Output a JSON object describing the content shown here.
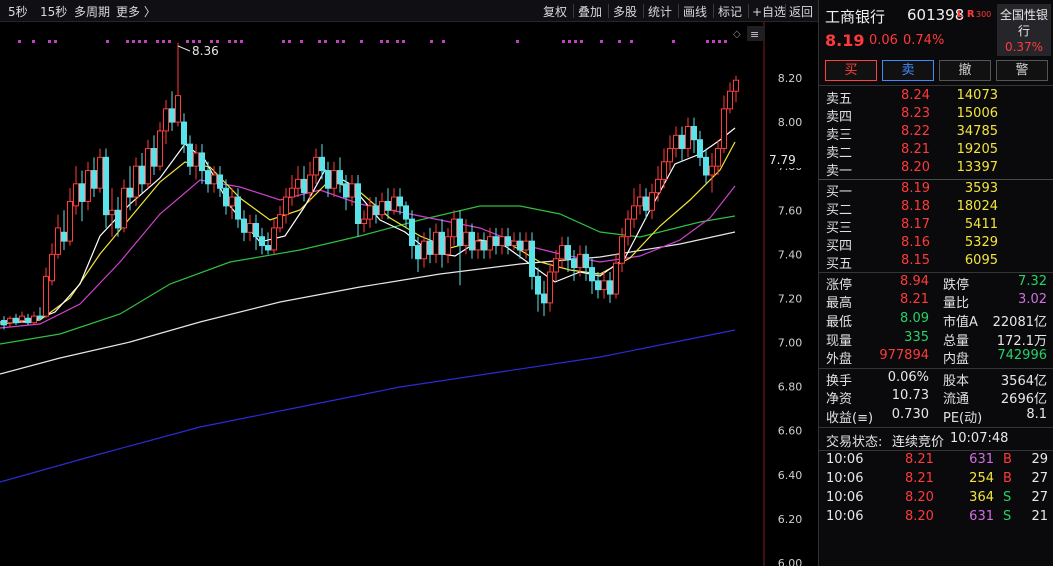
{
  "toolbar": {
    "left": [
      "5秒",
      "15秒",
      "多周期",
      "更多 〉"
    ],
    "right": [
      "复权",
      "叠加",
      "多股",
      "统计",
      "画线",
      "标记",
      "+自选",
      "返回"
    ]
  },
  "chart": {
    "peak_label": "8.36",
    "current_price_tag": "7.79",
    "y_ticks": [
      "8.20",
      "8.00",
      "7.80",
      "7.60",
      "7.40",
      "7.20",
      "7.00",
      "6.80",
      "6.60",
      "6.40",
      "6.20",
      "6.00"
    ],
    "colors": {
      "up": "#ff3b3b",
      "down": "#5be3ea",
      "ma5": "#ffffff",
      "ma10": "#f2e53c",
      "ma20": "#d040d0",
      "ma60": "#2fbf3f",
      "ma120": "#e6e6e6",
      "ma250": "#2b2bd8",
      "dots": "#c040c0"
    }
  },
  "stock": {
    "name": "工商银行",
    "code": "601398",
    "lr": "L R",
    "index": "300",
    "price": "8.19",
    "change": "0.06",
    "change_pct": "0.74%",
    "sector_line1": "全国性银",
    "sector_line2": "行",
    "sector_pct": "0.37%"
  },
  "buttons": {
    "buy": "买",
    "sell": "卖",
    "cancel": "撤",
    "alert": "警"
  },
  "order_book": {
    "asks": [
      {
        "label": "卖五",
        "price": "8.24",
        "volume": "14073"
      },
      {
        "label": "卖四",
        "price": "8.23",
        "volume": "15006"
      },
      {
        "label": "卖三",
        "price": "8.22",
        "volume": "34785"
      },
      {
        "label": "卖二",
        "price": "8.21",
        "volume": "19205"
      },
      {
        "label": "卖一",
        "price": "8.20",
        "volume": "13397"
      }
    ],
    "bids": [
      {
        "label": "买一",
        "price": "8.19",
        "volume": "3593"
      },
      {
        "label": "买二",
        "price": "8.18",
        "volume": "18024"
      },
      {
        "label": "买三",
        "price": "8.17",
        "volume": "5411"
      },
      {
        "label": "买四",
        "price": "8.16",
        "volume": "5329"
      },
      {
        "label": "买五",
        "price": "8.15",
        "volume": "6095"
      }
    ]
  },
  "stats": {
    "limit_up_label": "涨停",
    "limit_up": "8.94",
    "limit_down_label": "跌停",
    "limit_down": "7.32",
    "high_label": "最高",
    "high": "8.21",
    "vol_ratio_label": "量比",
    "vol_ratio": "3.02",
    "low_label": "最低",
    "low": "8.09",
    "mktcap_label": "市值A",
    "mktcap": "22081亿",
    "current_vol_label": "现量",
    "current_vol": "335",
    "total_vol_label": "总量",
    "total_vol": "172.1万",
    "outer_label": "外盘",
    "outer": "977894",
    "inner_label": "内盘",
    "inner": "742996",
    "turnover_label": "换手",
    "turnover": "0.06%",
    "shares_label": "股本",
    "shares": "3564亿",
    "nav_label": "净资",
    "nav": "10.73",
    "float_label": "流通",
    "float": "2696亿",
    "eps_label": "收益(≡)",
    "eps": "0.730",
    "pe_label": "PE(动)",
    "pe": "8.1"
  },
  "trade_status": {
    "label": "交易状态:",
    "value": "连续竞价",
    "time": "10:07:48"
  },
  "ticks": [
    {
      "time": "10:06",
      "price": "8.21",
      "vol": "631",
      "side": "B",
      "count": "29"
    },
    {
      "time": "10:06",
      "price": "8.21",
      "vol": "254",
      "side": "B",
      "count": "27"
    },
    {
      "time": "10:06",
      "price": "8.20",
      "vol": "364",
      "side": "S",
      "count": "27"
    },
    {
      "time": "10:06",
      "price": "8.20",
      "vol": "631",
      "side": "S",
      "count": "21"
    }
  ]
}
